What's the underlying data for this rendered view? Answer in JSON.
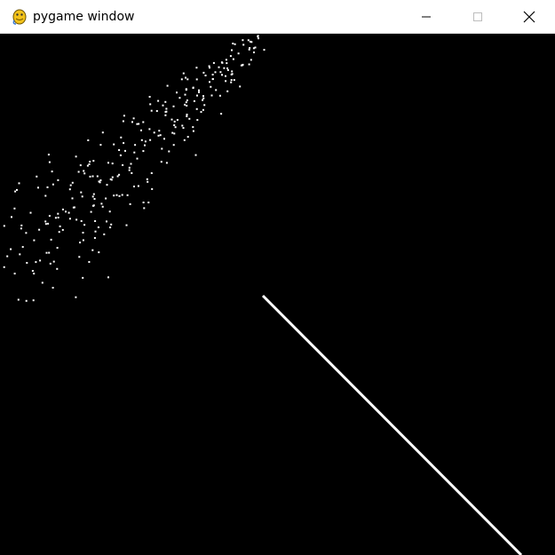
{
  "window": {
    "title": "pygame window",
    "icons": {
      "app": "pygame-snake-icon",
      "minimize": "minimize-icon",
      "maximize": "maximize-icon",
      "close": "close-icon"
    }
  },
  "canvas": {
    "background": "#000000",
    "foreground": "#ffffff"
  }
}
